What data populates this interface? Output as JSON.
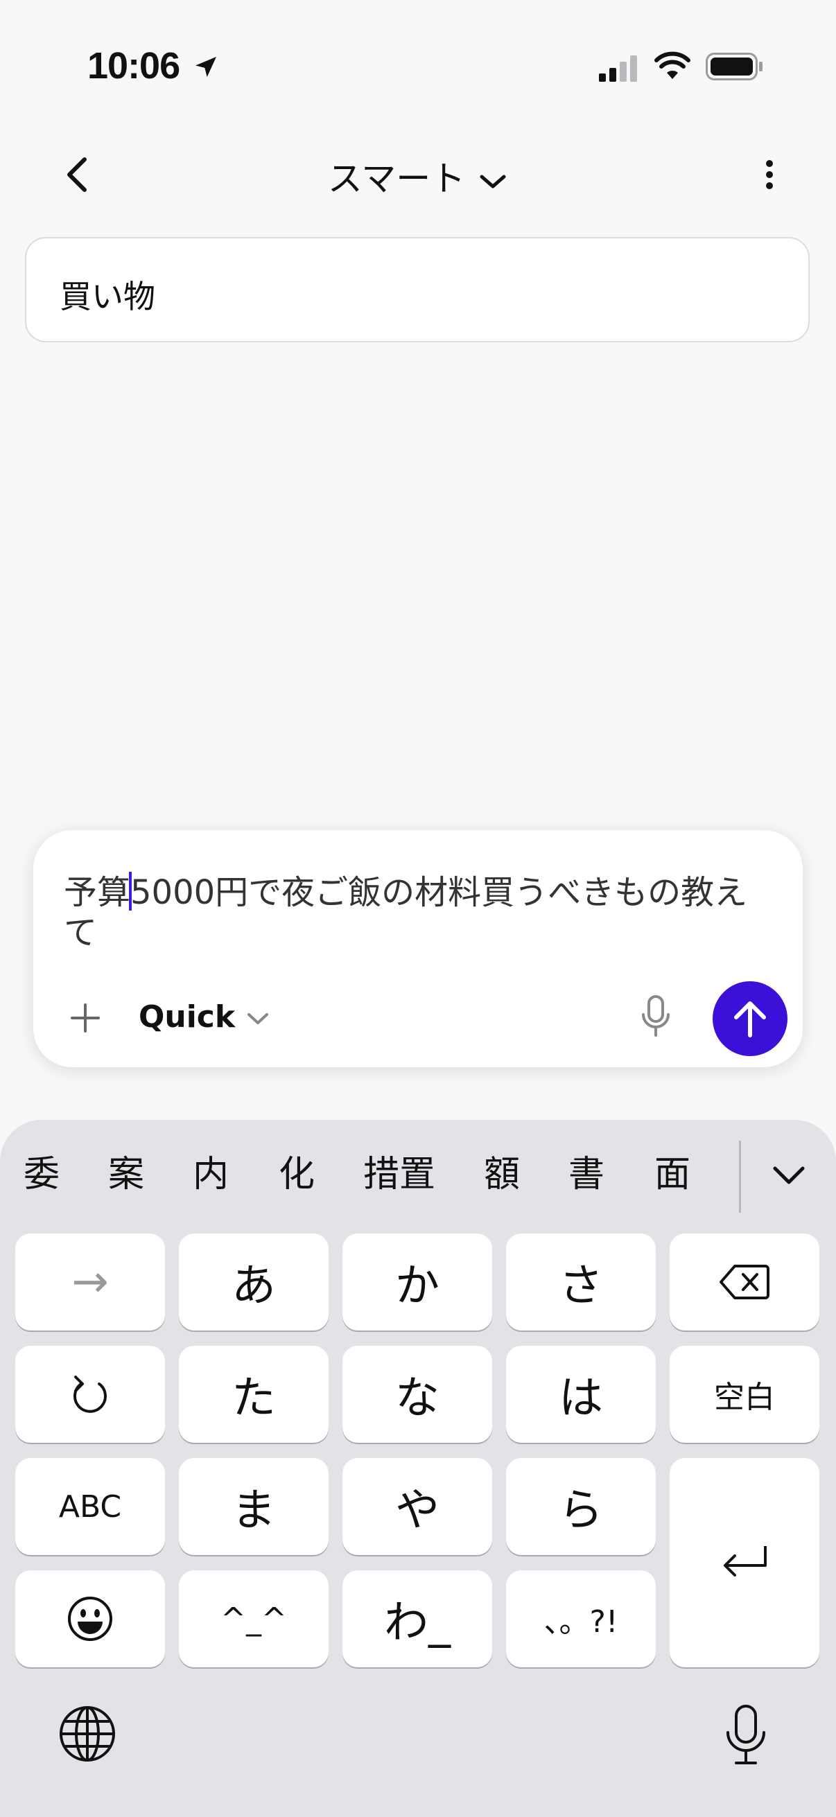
{
  "status_bar": {
    "time": "10:06"
  },
  "nav": {
    "title": "スマート"
  },
  "list": {
    "items": [
      "買い物"
    ]
  },
  "composer": {
    "text_before_caret": "予算",
    "text_after_caret": "5000円で夜ご飯の材料買うべきもの教えて",
    "mode_label": "Quick"
  },
  "keyboard": {
    "candidates": [
      "委",
      "案",
      "内",
      "化",
      "措置",
      "額",
      "書",
      "面"
    ],
    "keys": {
      "arrow": "→",
      "a": "あ",
      "ka": "か",
      "sa": "さ",
      "ta": "た",
      "na": "な",
      "ha": "は",
      "space": "空白",
      "abc": "ABC",
      "ma": "ま",
      "ya": "や",
      "ra": "ら",
      "kaomoji": "^_^",
      "wa": "わ_",
      "punct": "、。?!"
    }
  },
  "colors": {
    "accent": "#3b10d8",
    "background": "#f8f8f9",
    "keyboard_bg": "#e2e3e7"
  }
}
